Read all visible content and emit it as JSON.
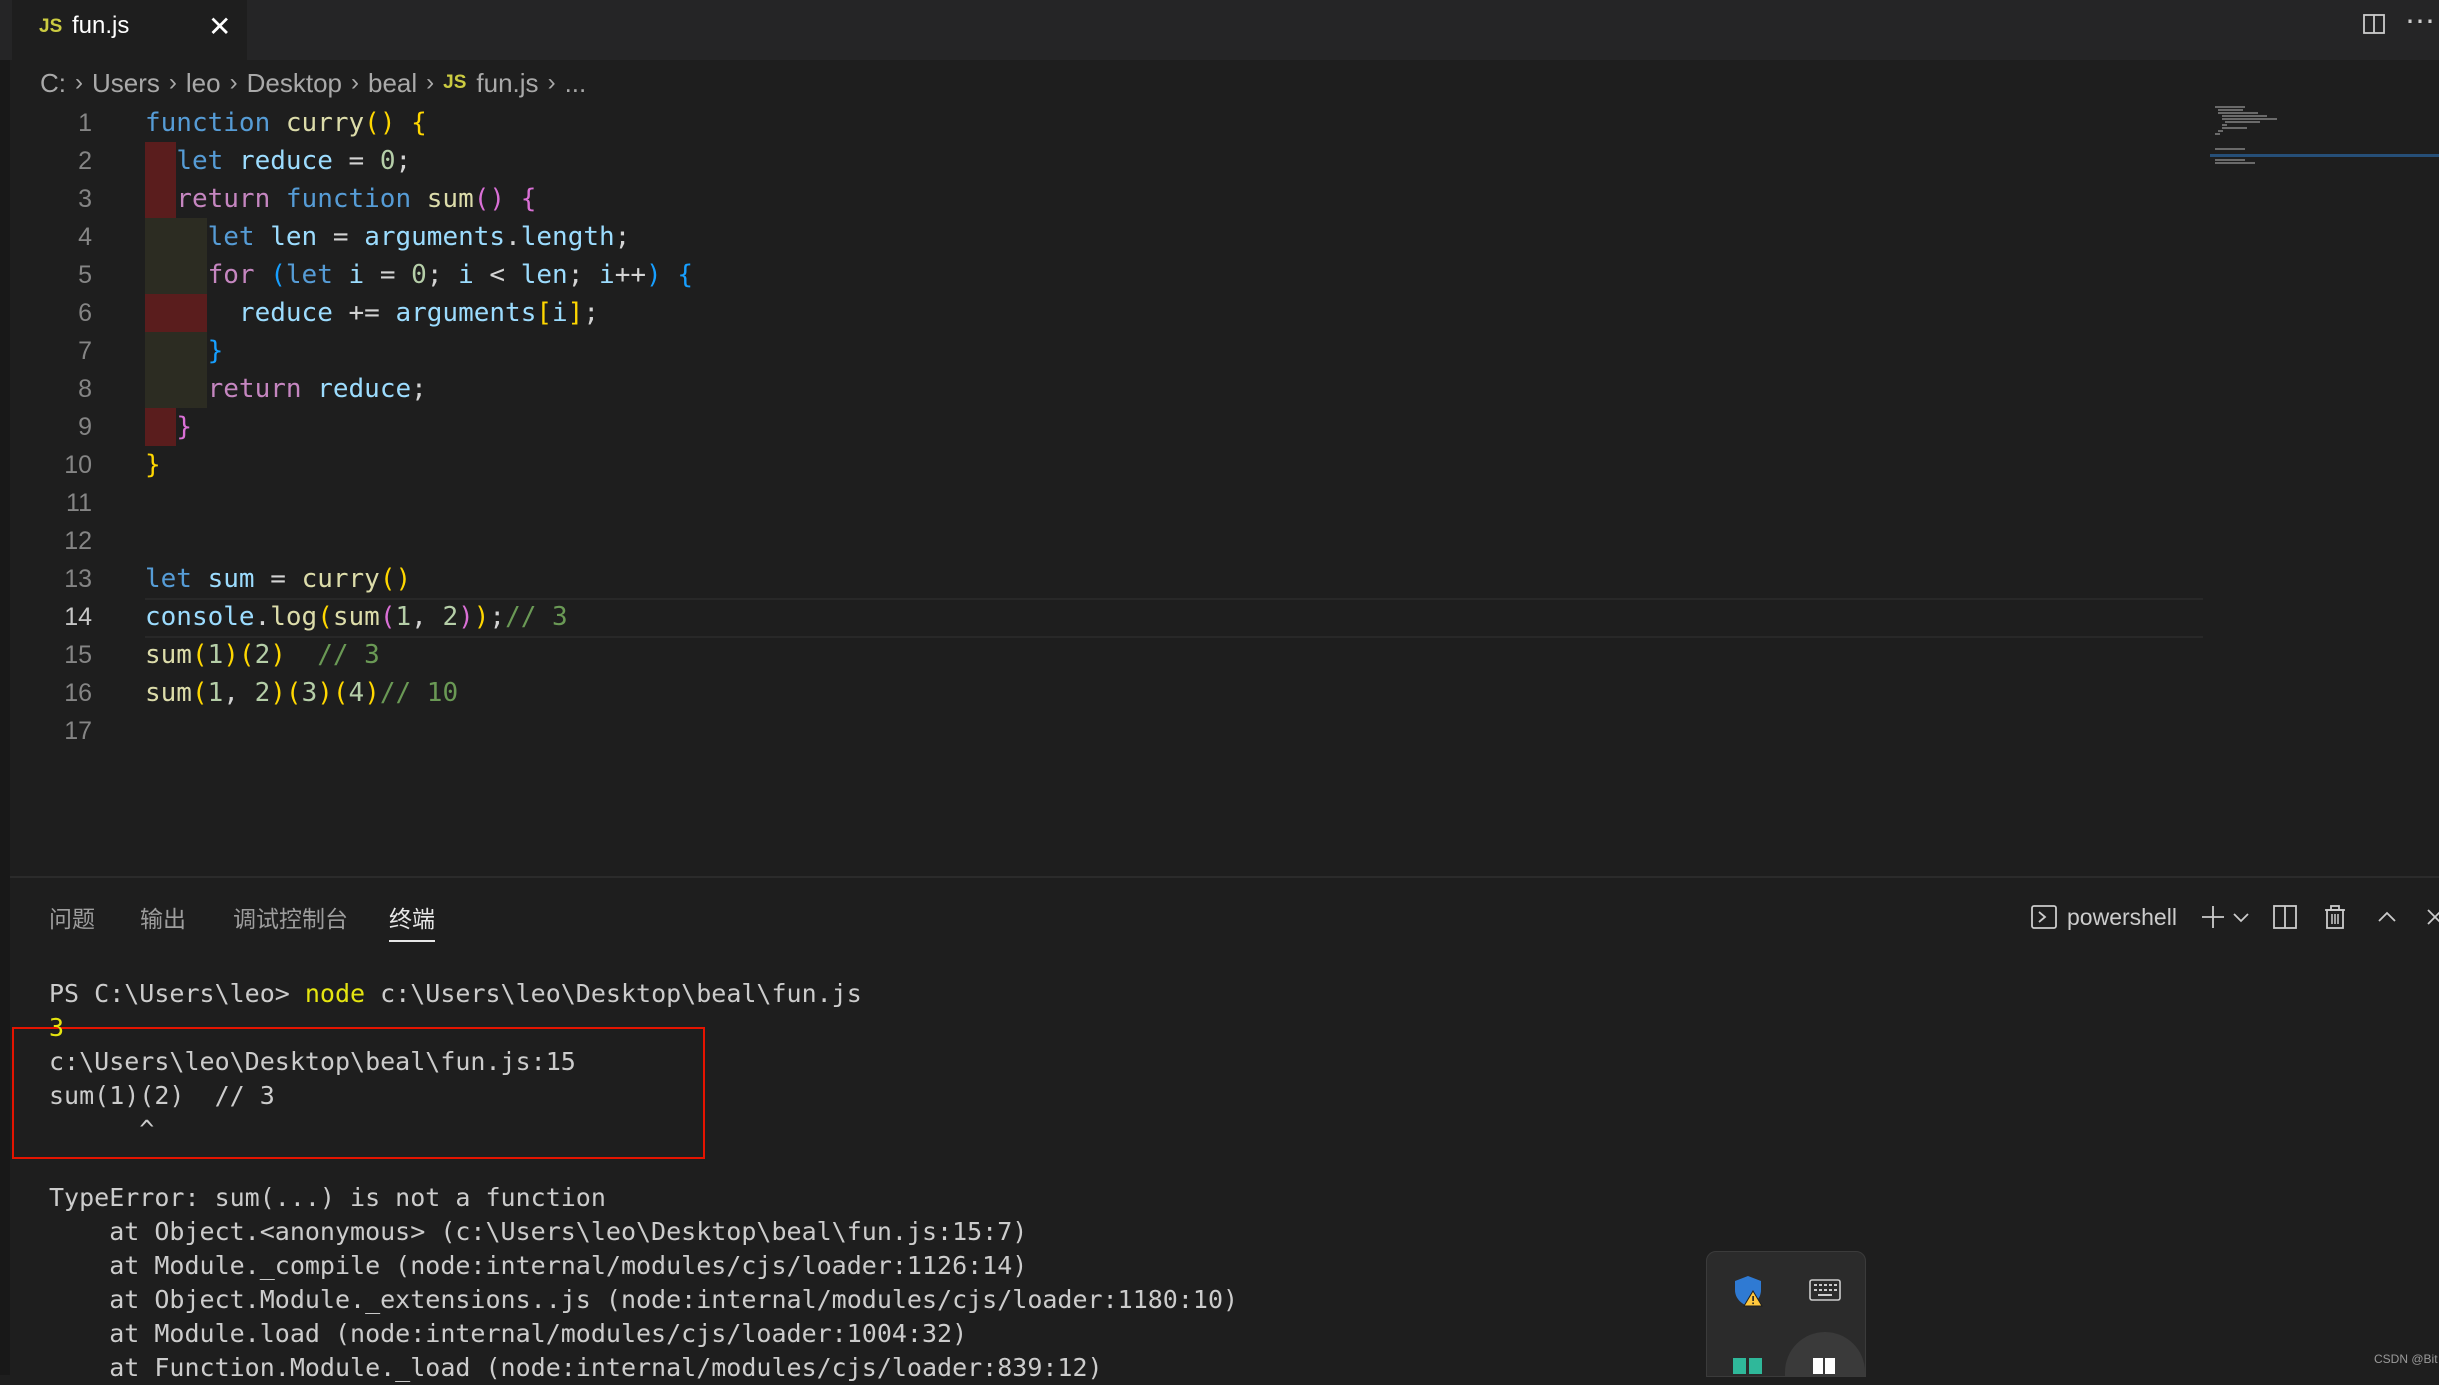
{
  "tab": {
    "icon": "js-file-icon",
    "label": "fun.js",
    "close_glyph": "✕"
  },
  "toolbar": {
    "split_icon": "split-editor-icon",
    "more_glyph": "⋯"
  },
  "breadcrumb": {
    "parts": [
      "C:",
      "Users",
      "leo",
      "Desktop",
      "beal"
    ],
    "file_icon": "JS",
    "file": "fun.js",
    "tail": "..."
  },
  "editor": {
    "line_numbers": [
      "1",
      "2",
      "3",
      "4",
      "5",
      "6",
      "7",
      "8",
      "9",
      "10",
      "11",
      "12",
      "13",
      "14",
      "15",
      "16",
      "17"
    ],
    "active_line": "14"
  },
  "panel": {
    "tabs": [
      "问题",
      "输出",
      "调试控制台",
      "终端"
    ],
    "active_tab": "终端",
    "shell": "powershell"
  },
  "terminal": {
    "prompt": "PS C:\\Users\\leo> ",
    "command_word": "node",
    "command_args": " c:\\Users\\leo\\Desktop\\beal\\fun.js",
    "output_first": "3",
    "lines": [
      "c:\\Users\\leo\\Desktop\\beal\\fun.js:15",
      "sum(1)(2)  // 3",
      "      ^",
      "",
      "TypeError: sum(...) is not a function",
      "    at Object.<anonymous> (c:\\Users\\leo\\Desktop\\beal\\fun.js:15:7)",
      "    at Module._compile (node:internal/modules/cjs/loader:1126:14)",
      "    at Object.Module._extensions..js (node:internal/modules/cjs/loader:1180:10)",
      "    at Module.load (node:internal/modules/cjs/loader:1004:32)",
      "    at Function.Module._load (node:internal/modules/cjs/loader:839:12)"
    ]
  },
  "watermark": "CSDN @Bit"
}
